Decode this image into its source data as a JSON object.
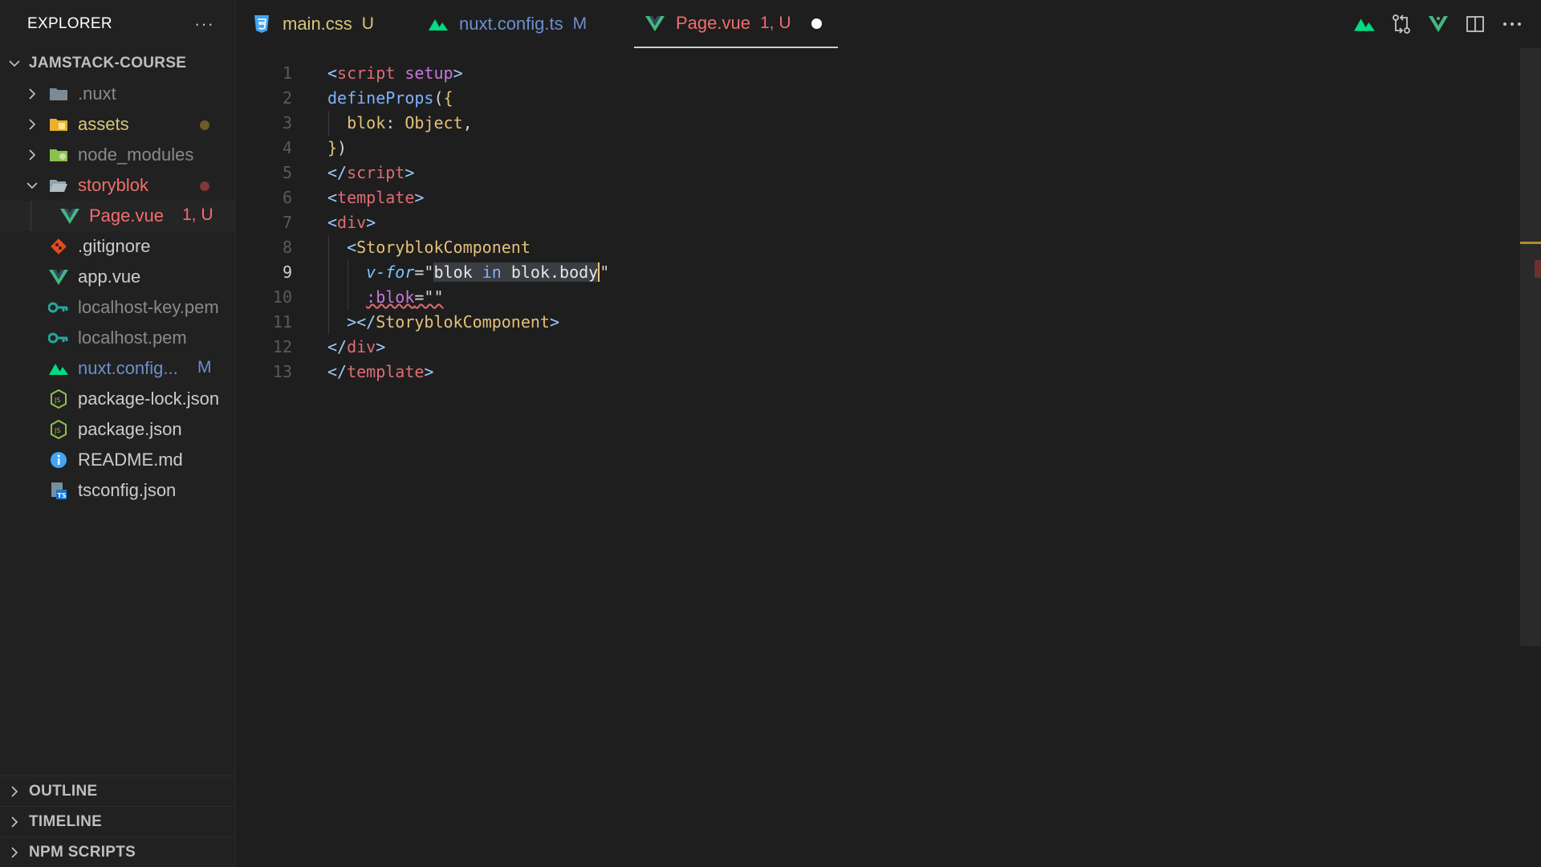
{
  "explorer": {
    "title": "EXPLORER",
    "more": "···",
    "project": "JAMSTACK-COURSE",
    "items": [
      {
        "name": ".nuxt",
        "type": "folder",
        "badge": ""
      },
      {
        "name": "assets",
        "type": "folder",
        "badge": ""
      },
      {
        "name": "node_modules",
        "type": "folder",
        "badge": ""
      },
      {
        "name": "storyblok",
        "type": "folder-open",
        "badge": ""
      },
      {
        "name": "Page.vue",
        "type": "vue",
        "badge": "1, U"
      },
      {
        "name": ".gitignore",
        "type": "git",
        "badge": ""
      },
      {
        "name": "app.vue",
        "type": "vue",
        "badge": ""
      },
      {
        "name": "localhost-key.pem",
        "type": "key",
        "badge": ""
      },
      {
        "name": "localhost.pem",
        "type": "key",
        "badge": ""
      },
      {
        "name": "nuxt.config...",
        "type": "nuxt",
        "badge": "M"
      },
      {
        "name": "package-lock.json",
        "type": "node",
        "badge": ""
      },
      {
        "name": "package.json",
        "type": "node",
        "badge": ""
      },
      {
        "name": "README.md",
        "type": "info",
        "badge": ""
      },
      {
        "name": "tsconfig.json",
        "type": "ts",
        "badge": ""
      }
    ],
    "panels": [
      "OUTLINE",
      "TIMELINE",
      "NPM SCRIPTS"
    ]
  },
  "tabs": [
    {
      "label": "main.css",
      "status": "U",
      "icon": "css-icon"
    },
    {
      "label": "nuxt.config.ts",
      "status": "M",
      "icon": "nuxt-icon"
    },
    {
      "label": "Page.vue",
      "status": "1, U",
      "icon": "vue-icon"
    }
  ],
  "editor": {
    "line_numbers": [
      "1",
      "2",
      "3",
      "4",
      "5",
      "6",
      "7",
      "8",
      "9",
      "10",
      "11",
      "12",
      "13"
    ],
    "current_line": 9
  },
  "colors": {
    "accent_red": "#ef6f6c",
    "modified": "#6c8fce",
    "untracked_green": "#73c991"
  }
}
